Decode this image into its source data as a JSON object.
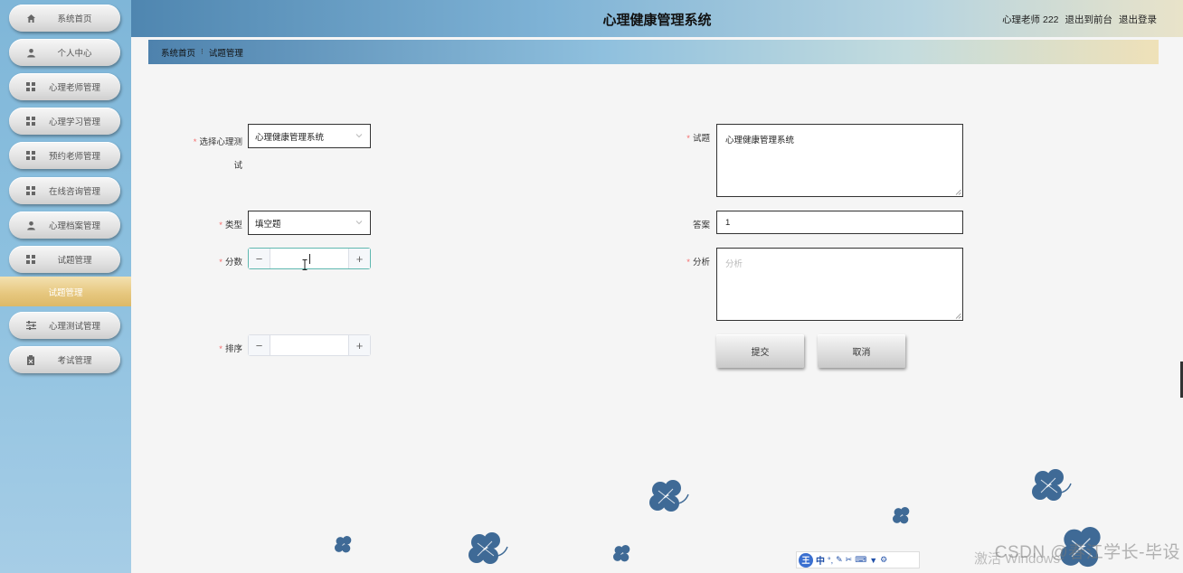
{
  "app": {
    "title": "心理健康管理系统",
    "user_label": "心理老师 222",
    "link_front": "退出到前台",
    "link_logout": "退出登录"
  },
  "sidebar": {
    "items": [
      {
        "label": "系统首页",
        "icon": "home-icon"
      },
      {
        "label": "个人中心",
        "icon": "person-icon"
      },
      {
        "label": "心理老师管理",
        "icon": "grid-icon"
      },
      {
        "label": "心理学习管理",
        "icon": "grid-icon"
      },
      {
        "label": "预约老师管理",
        "icon": "grid-icon"
      },
      {
        "label": "在线咨询管理",
        "icon": "grid-icon"
      },
      {
        "label": "心理档案管理",
        "icon": "person-icon"
      },
      {
        "label": "试题管理",
        "icon": "grid-icon"
      },
      {
        "label": "心理测试管理",
        "icon": "sliders-icon"
      },
      {
        "label": "考试管理",
        "icon": "clipboard-icon"
      }
    ],
    "active_sub": "试题管理"
  },
  "breadcrumb": {
    "home": "系统首页",
    "separator": "⁝",
    "current": "试题管理"
  },
  "form": {
    "test_select": {
      "label": "选择心理测试",
      "value": "心理健康管理系统"
    },
    "question": {
      "label": "试题",
      "value": "心理健康管理系统"
    },
    "type": {
      "label": "类型",
      "value": "填空题"
    },
    "answer": {
      "label": "答案",
      "value": "1"
    },
    "score": {
      "label": "分数",
      "minus": "−",
      "plus": "+",
      "value": ""
    },
    "analysis": {
      "label": "分析",
      "placeholder": "分析"
    },
    "order": {
      "label": "排序",
      "minus": "−",
      "plus": "+",
      "value": ""
    },
    "submit": "提交",
    "cancel": "取消"
  },
  "ime_toolbar": {
    "logo": "王",
    "mode": "中"
  },
  "watermark": "CSDN @春江学长-毕设",
  "windows_activation": "激活 Windows",
  "colors": {
    "required": "#f56c6c",
    "active_menu": "#e7c880",
    "flower": "#3f6a96"
  }
}
